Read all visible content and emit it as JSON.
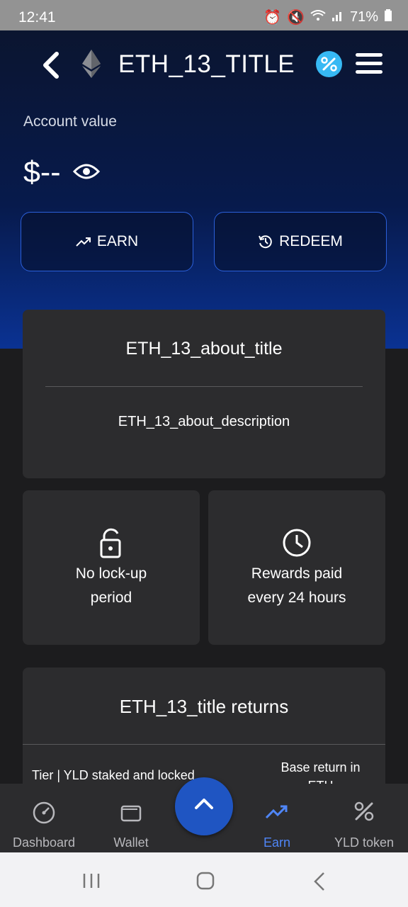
{
  "status_bar": {
    "time": "12:41",
    "battery": "71%"
  },
  "header": {
    "title": "ETH_13_TITLE"
  },
  "account": {
    "label": "Account value",
    "value": "$--"
  },
  "actions": {
    "earn_label": "EARN",
    "redeem_label": "REDEEM"
  },
  "about": {
    "title": "ETH_13_about_title",
    "description": "ETH_13_about_description"
  },
  "features": [
    {
      "line1": "No lock-up",
      "line2": "period",
      "icon": "lock-icon"
    },
    {
      "line1": "Rewards paid",
      "line2": "every 24 hours",
      "icon": "clock-icon"
    }
  ],
  "returns": {
    "title": "ETH_13_title returns",
    "col1": "Tier | YLD staked and locked",
    "col2_line1": "Base return in",
    "col2_line2": "ETH"
  },
  "bottom_nav": [
    {
      "label": "Dashboard",
      "icon": "gauge-icon",
      "active": false
    },
    {
      "label": "Wallet",
      "icon": "wallet-icon",
      "active": false
    },
    {
      "label": "Earn",
      "icon": "trending-up-icon",
      "active": true
    },
    {
      "label": "YLD token",
      "icon": "percent-icon",
      "active": false
    }
  ],
  "colors": {
    "accent": "#2b5fd9",
    "active_nav": "#4f86f7",
    "fab": "#1f55c2"
  }
}
